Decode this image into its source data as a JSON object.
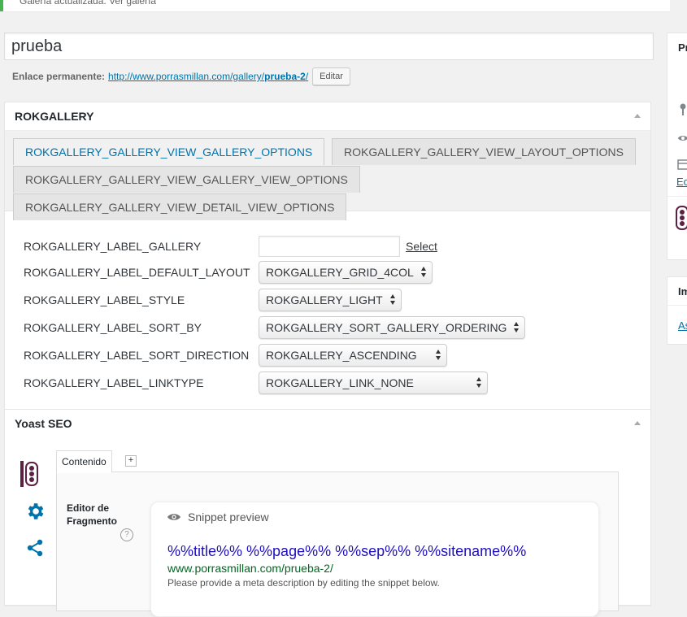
{
  "notice": {
    "text": "Galería actualizada. Ver galería"
  },
  "post": {
    "title_value": "prueba",
    "permalink_label": "Enlace permanente:",
    "permalink_base": "http://www.porrasmillan.com/gallery/",
    "permalink_slug": "prueba-2",
    "permalink_trail": "/",
    "edit_button": "Editar"
  },
  "rokgallery": {
    "title": "ROKGALLERY",
    "tabs": [
      "ROKGALLERY_GALLERY_VIEW_GALLERY_OPTIONS",
      "ROKGALLERY_GALLERY_VIEW_LAYOUT_OPTIONS",
      "ROKGALLERY_GALLERY_VIEW_GALLERY_VIEW_OPTIONS",
      "ROKGALLERY_GALLERY_VIEW_DETAIL_VIEW_OPTIONS"
    ],
    "active_tab_index": 0,
    "fields": {
      "gallery_label": "ROKGALLERY_LABEL_GALLERY",
      "gallery_value": "",
      "select_link": "Select",
      "default_layout_label": "ROKGALLERY_LABEL_DEFAULT_LAYOUT",
      "default_layout_value": "ROKGALLERY_GRID_4COL",
      "style_label": "ROKGALLERY_LABEL_STYLE",
      "style_value": "ROKGALLERY_LIGHT",
      "sort_by_label": "ROKGALLERY_LABEL_SORT_BY",
      "sort_by_value": "ROKGALLERY_SORT_GALLERY_ORDERING",
      "sort_direction_label": "ROKGALLERY_LABEL_SORT_DIRECTION",
      "sort_direction_value": "ROKGALLERY_ASCENDING",
      "linktype_label": "ROKGALLERY_LABEL_LINKTYPE",
      "linktype_value": "ROKGALLERY_LINK_NONE"
    }
  },
  "yoast": {
    "title": "Yoast SEO",
    "content_tab": "Contenido",
    "add_tab": "+",
    "editor_title": "Editor de Fragmento",
    "help": "?",
    "snippet_label": "Snippet preview",
    "snippet_title": "%%title%% %%page%% %%sep%% %%sitename%%",
    "snippet_url": "www.porrasmillan.com/prueba-2/",
    "snippet_desc": "Please provide a meta description by editing the snippet below."
  },
  "right": {
    "publish_initial": "Pr",
    "edit_link": "Ec",
    "box2_initial": "Im",
    "box2_link": "As"
  },
  "colors": {
    "accent": "#0073aa",
    "yoast_purple": "#5b2143",
    "yoast_blue": "#0073aa",
    "notice_green": "#46b450",
    "snippet_title": "#1e0fbe",
    "snippet_url": "#006621"
  }
}
